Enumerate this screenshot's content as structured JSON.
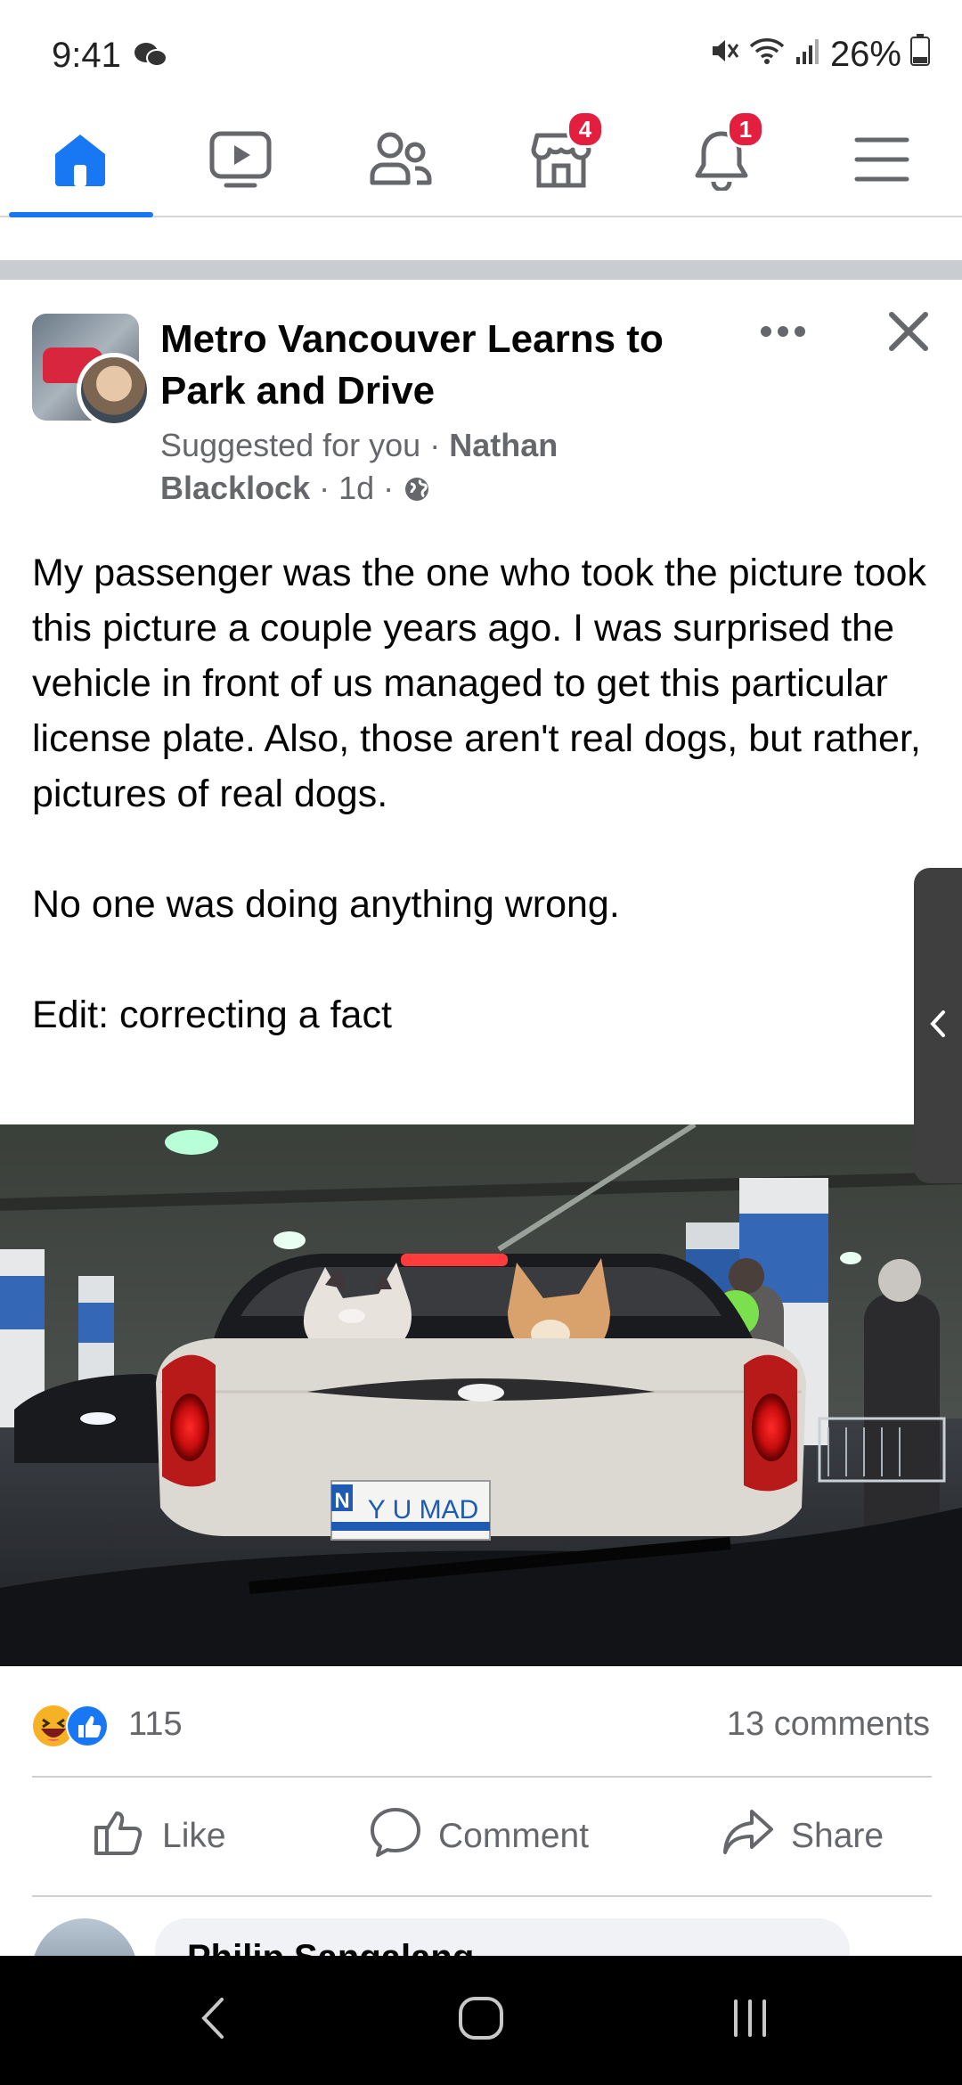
{
  "status_bar": {
    "time": "9:41",
    "battery": "26%",
    "icons": [
      "chat-bubble-icon",
      "mute-icon",
      "wifi-icon",
      "signal-icon",
      "battery-icon"
    ]
  },
  "nav": {
    "tabs": [
      {
        "name": "home",
        "icon": "home-icon",
        "active": true
      },
      {
        "name": "watch",
        "icon": "video-icon"
      },
      {
        "name": "friends",
        "icon": "friends-icon"
      },
      {
        "name": "marketplace",
        "icon": "marketplace-icon",
        "badge": "4"
      },
      {
        "name": "notifications",
        "icon": "bell-icon",
        "badge": "1"
      },
      {
        "name": "menu",
        "icon": "hamburger-menu-icon"
      }
    ],
    "accent": "#1877f2",
    "badge_color": "#e41e3f"
  },
  "post": {
    "group_name": "Metro Vancouver Learns to Park and Drive",
    "suggested": "Suggested for you",
    "dot": " · ",
    "author": "Nathan Blacklock",
    "time": "1d",
    "body": "My passenger was the one who took the picture took this picture a couple years ago. I was surprised the vehicle in front of us managed to get this particular license plate. Also, those aren't real dogs, but rather, pictures of real dogs.\n\nNo one was doing anything wrong.\n\nEdit: correcting a fact",
    "photo": {
      "plate_text": "Y U MAD",
      "plate_prefix": "N"
    },
    "reactions": {
      "count": "115",
      "types": [
        "haha-icon",
        "like-icon"
      ]
    },
    "comments_count": "13 comments",
    "actions": {
      "like": "Like",
      "comment": "Comment",
      "share": "Share"
    },
    "first_comment_author": "Philip Sangalang"
  }
}
